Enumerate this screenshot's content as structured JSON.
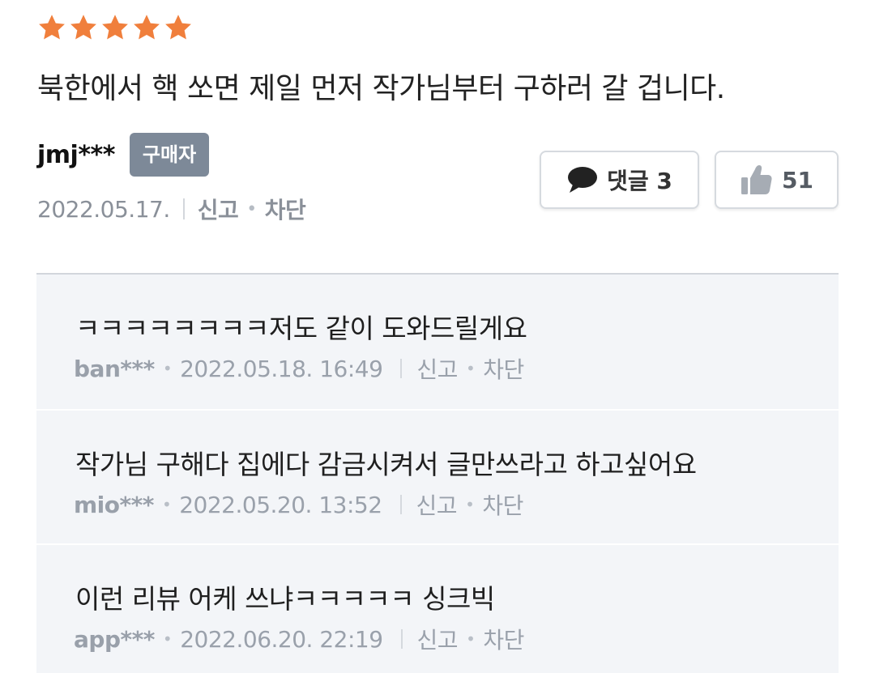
{
  "review": {
    "rating": 5,
    "rating_max": 5,
    "star_color": "#f07f3c",
    "text": "북한에서 핵 쏘면 제일 먼저 작가님부터 구하러 갈 겁니다.",
    "author": "jmj***",
    "badge": "구매자",
    "date": "2022.05.17.",
    "report_label": "신고",
    "block_label": "차단",
    "comment_button_label": "댓글 3",
    "like_count": "51"
  },
  "comments": [
    {
      "text": "ㅋㅋㅋㅋㅋㅋㅋㅋ저도 같이 도와드릴게요",
      "author": "ban***",
      "datetime": "2022.05.18. 16:49",
      "report_label": "신고",
      "block_label": "차단"
    },
    {
      "text": "작가님 구해다 집에다 감금시켜서 글만쓰라고 하고싶어요",
      "author": "mio***",
      "datetime": "2022.05.20. 13:52",
      "report_label": "신고",
      "block_label": "차단"
    },
    {
      "text": "이런 리뷰 어케 쓰냐ㅋㅋㅋㅋㅋ 싱크빅",
      "author": "app***",
      "datetime": "2022.06.20. 22:19",
      "report_label": "신고",
      "block_label": "차단"
    }
  ],
  "icons": {
    "star": "star-icon",
    "comment": "speech-bubble-icon",
    "like": "thumbs-up-icon"
  },
  "colors": {
    "badge_bg": "#7d8998",
    "comments_bg": "#f3f5f8"
  }
}
